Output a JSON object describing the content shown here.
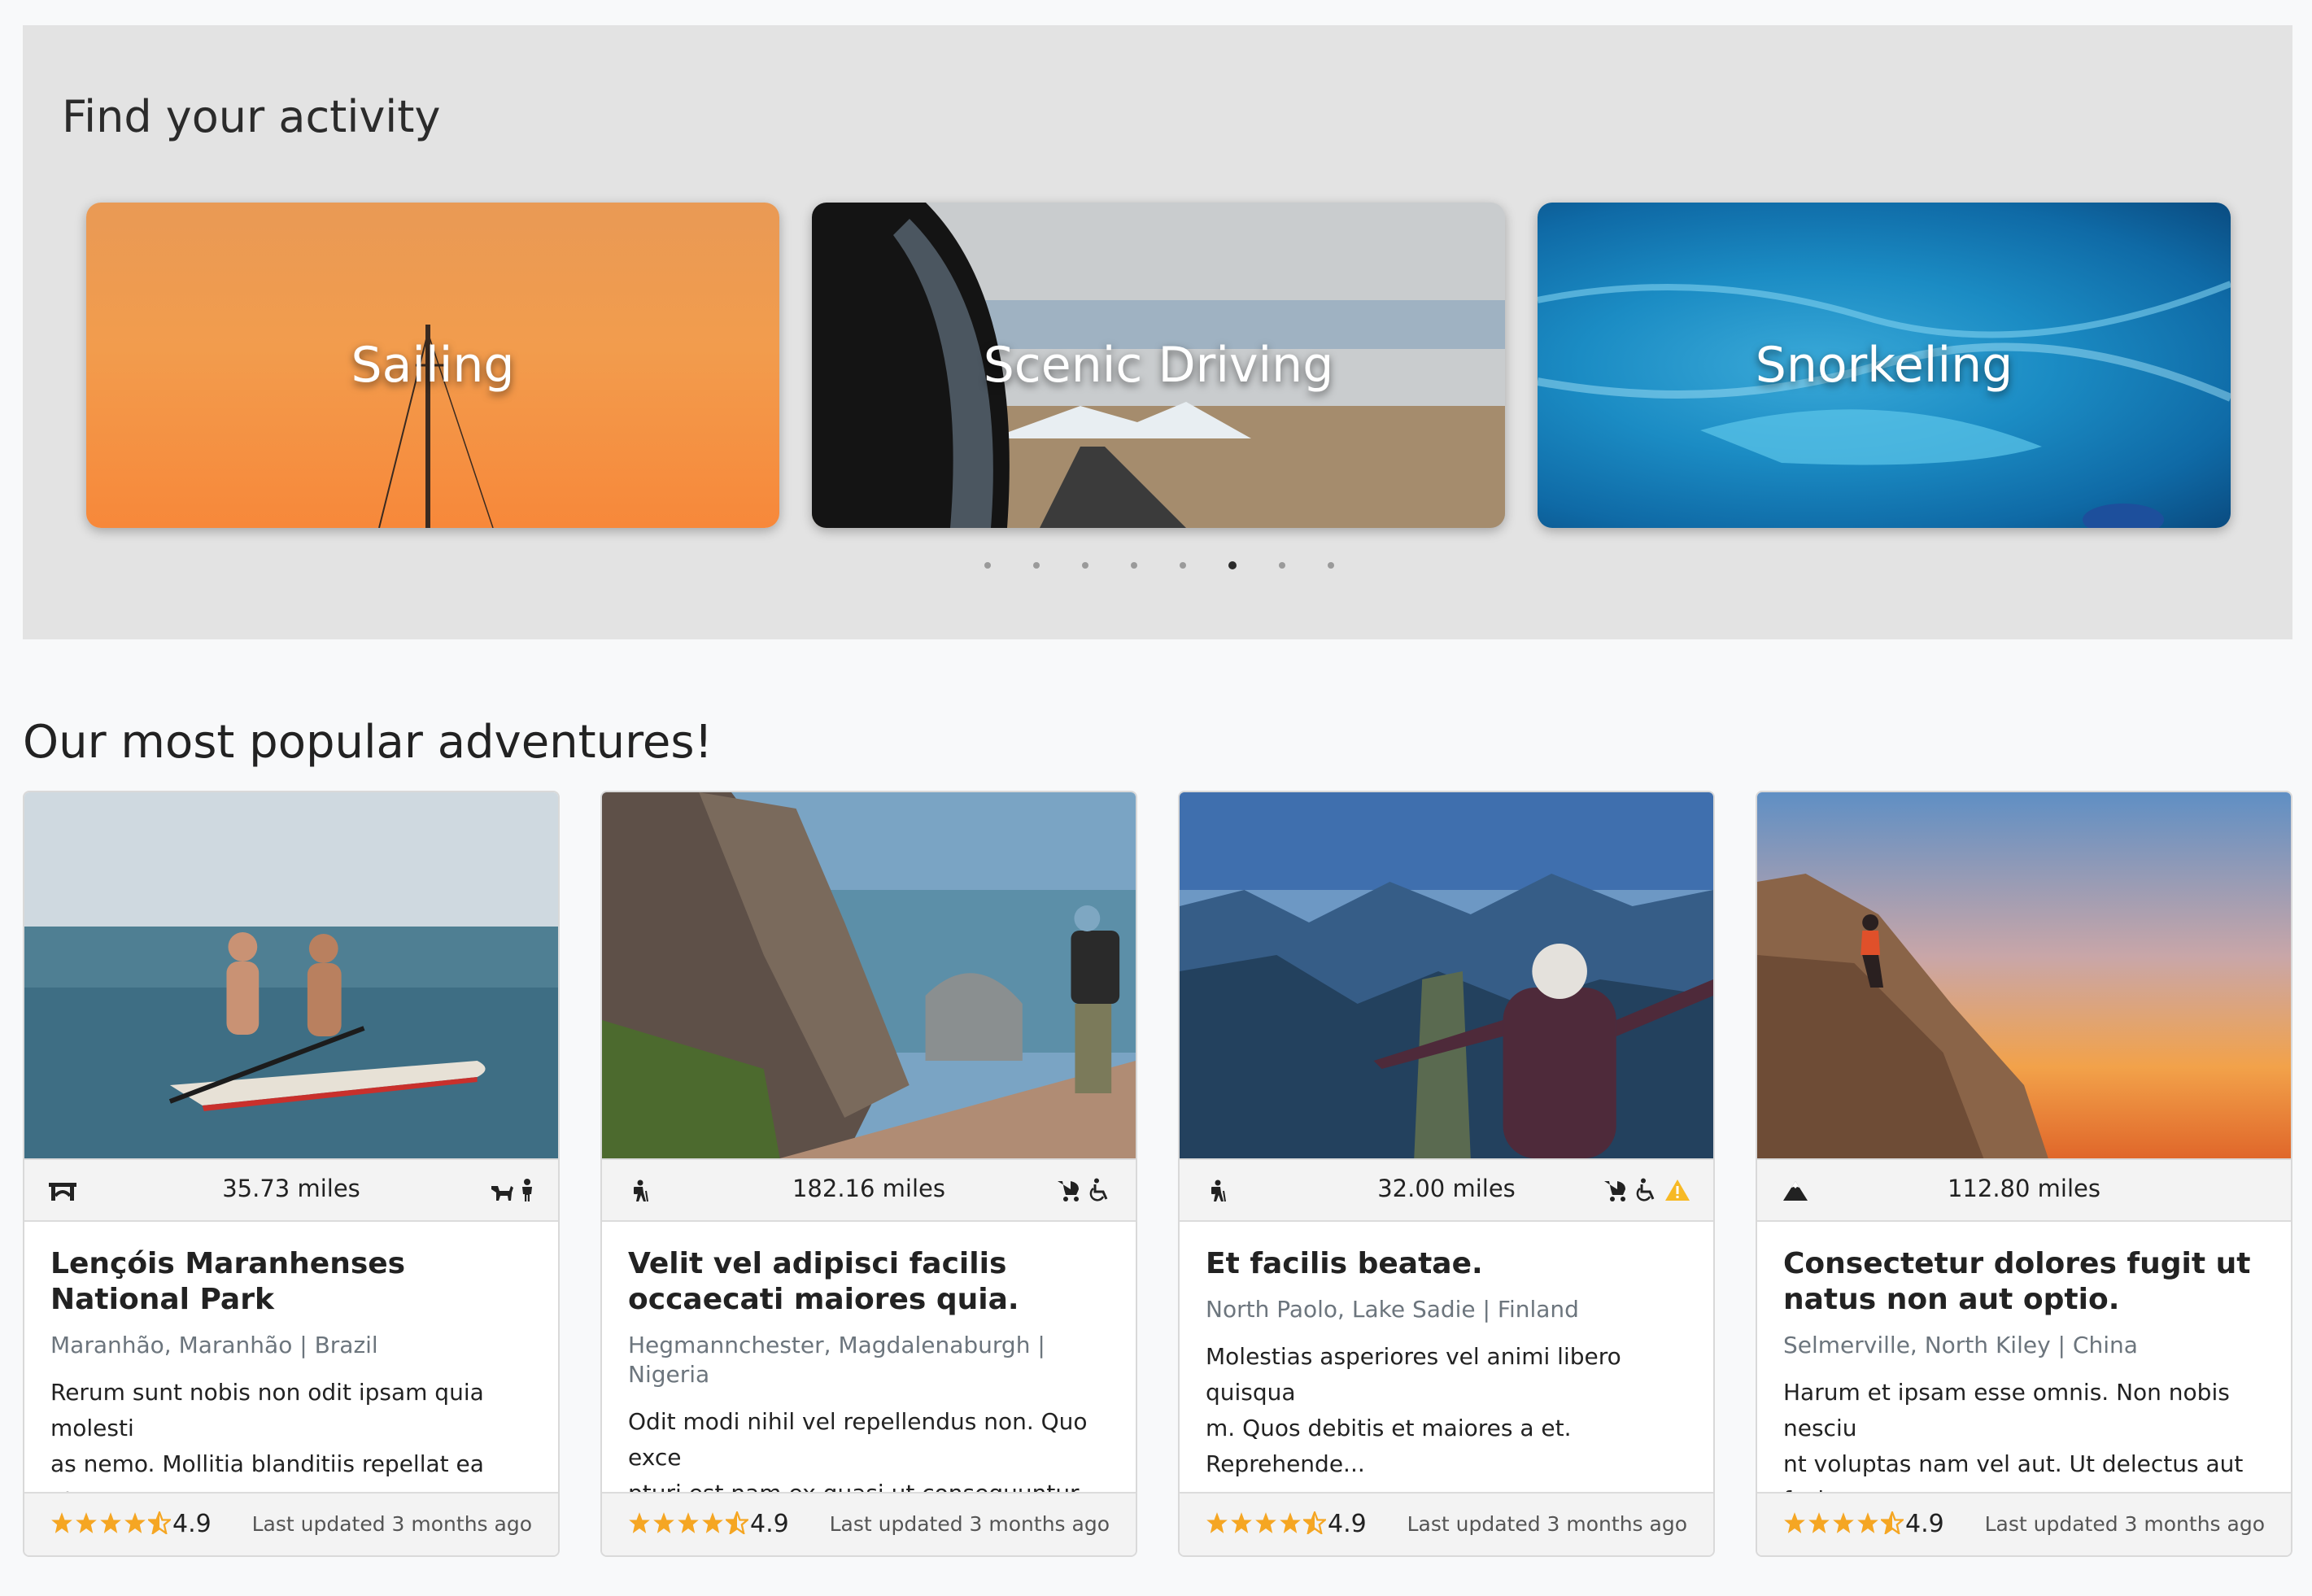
{
  "activities": {
    "title": "Find your activity",
    "cards": [
      {
        "label": "Sailing"
      },
      {
        "label": "Scenic Driving"
      },
      {
        "label": "Snorkeling"
      }
    ],
    "dots": 8,
    "active_dot": 6
  },
  "popular": {
    "title": "Our most popular adventures!",
    "cards": [
      {
        "activity_icon": "bridge-icon",
        "distance": "35.73 miles",
        "feature_icons": [
          "dog-icon",
          "child-icon"
        ],
        "name": "Lençóis Maranhenses National Park",
        "location": "Maranhão, Maranhão | Brazil",
        "description_line1": "Rerum sunt nobis non odit ipsam quia molesti",
        "description_line2": "as nemo. Mollitia blanditiis repellat ea atque...",
        "rating": "4.9",
        "updated": "Last updated 3 months ago"
      },
      {
        "activity_icon": "hiker-icon",
        "distance": "182.16 miles",
        "feature_icons": [
          "stroller-icon",
          "wheelchair-icon"
        ],
        "name": "Velit vel adipisci facilis occaecati maiores quia.",
        "location": "Hegmannchester, Magdalenaburgh | Nigeria",
        "description_line1": "Odit modi nihil vel repellendus non. Quo exce",
        "description_line2": "pturi est nam ex quasi ut consequuntur iusto...",
        "rating": "4.9",
        "updated": "Last updated 3 months ago"
      },
      {
        "activity_icon": "hiker-icon",
        "distance": "32.00 miles",
        "feature_icons": [
          "stroller-icon",
          "wheelchair-icon",
          "warning-icon"
        ],
        "name": "Et facilis beatae.",
        "location": "North Paolo, Lake Sadie | Finland",
        "description_line1": "Molestias asperiores vel animi libero quisqua",
        "description_line2": "m. Quos debitis et maiores a et. Reprehende...",
        "rating": "4.9",
        "updated": "Last updated 3 months ago"
      },
      {
        "activity_icon": "mountain-icon",
        "distance": "112.80 miles",
        "feature_icons": [],
        "name": "Consectetur dolores fugit ut natus non aut optio.",
        "location": "Selmerville, North Kiley | China",
        "description_line1": "Harum et ipsam esse omnis. Non nobis nesciu",
        "description_line2": "nt voluptas nam vel aut. Ut delectus aut faci...",
        "rating": "4.9",
        "updated": "Last updated 3 months ago"
      }
    ]
  },
  "colors": {
    "star": "#f5a623",
    "warning": "#f7b924",
    "section_bg": "#e3e3e3"
  }
}
